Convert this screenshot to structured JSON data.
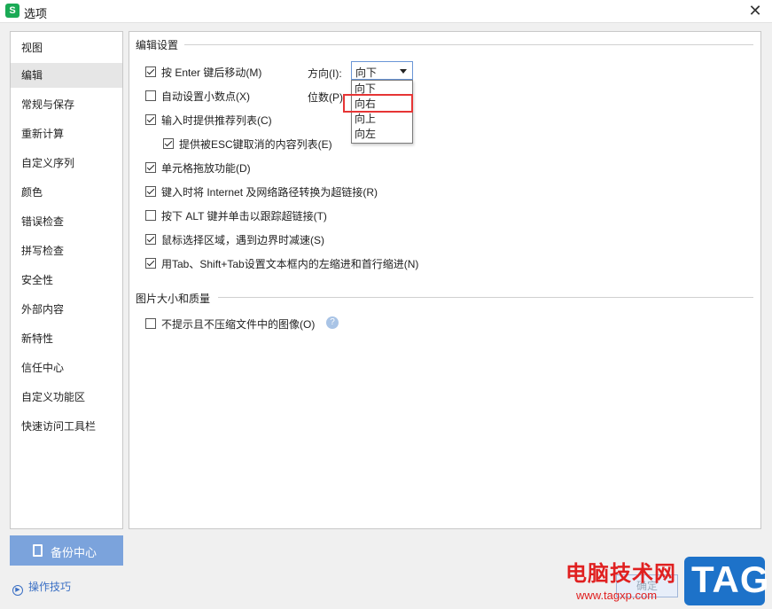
{
  "window": {
    "title": "选项",
    "app_icon": "S"
  },
  "sidebar": {
    "items": [
      {
        "label": "视图"
      },
      {
        "label": "编辑",
        "active": true
      },
      {
        "label": "常规与保存"
      },
      {
        "label": "重新计算"
      },
      {
        "label": "自定义序列"
      },
      {
        "label": "颜色"
      },
      {
        "label": "错误检查"
      },
      {
        "label": "拼写检查"
      },
      {
        "label": "安全性"
      },
      {
        "label": "外部内容"
      },
      {
        "label": "新特性"
      },
      {
        "label": "信任中心"
      },
      {
        "label": "自定义功能区"
      },
      {
        "label": "快速访问工具栏"
      }
    ],
    "backup_label": "备份中心",
    "tips_label": "操作技巧"
  },
  "edit_settings": {
    "title": "编辑设置",
    "options": [
      {
        "label": "按 Enter 键后移动(M)",
        "checked": true
      },
      {
        "label": "自动设置小数点(X)",
        "checked": false
      },
      {
        "label": "输入时提供推荐列表(C)",
        "checked": true
      },
      {
        "label": "提供被ESC键取消的内容列表(E)",
        "checked": true
      },
      {
        "label": "单元格拖放功能(D)",
        "checked": true
      },
      {
        "label": "键入时将 Internet 及网络路径转换为超链接(R)",
        "checked": true
      },
      {
        "label": "按下 ALT 键并单击以跟踪超链接(T)",
        "checked": false
      },
      {
        "label": "鼠标选择区域，遇到边界时减速(S)",
        "checked": true
      },
      {
        "label": "用Tab、Shift+Tab设置文本框内的左缩进和首行缩进(N)",
        "checked": true
      }
    ],
    "direction_label": "方向(I):",
    "direction_value": "向下",
    "direction_options": [
      "向下",
      "向右",
      "向上",
      "向左"
    ],
    "decimal_label": "位数(P)"
  },
  "image_settings": {
    "title": "图片大小和质量",
    "options": [
      {
        "label": "不提示且不压缩文件中的图像(O)",
        "checked": false
      }
    ],
    "help_glyph": "?"
  },
  "footer": {
    "ok_label": "确定"
  },
  "watermark": {
    "site_name": "电脑技术网",
    "url": "www.tagxp.com",
    "tag": "TAG"
  },
  "colors": {
    "accent": "#7ba3dc",
    "highlight_border": "#e63535",
    "link": "#3a6fc4"
  }
}
